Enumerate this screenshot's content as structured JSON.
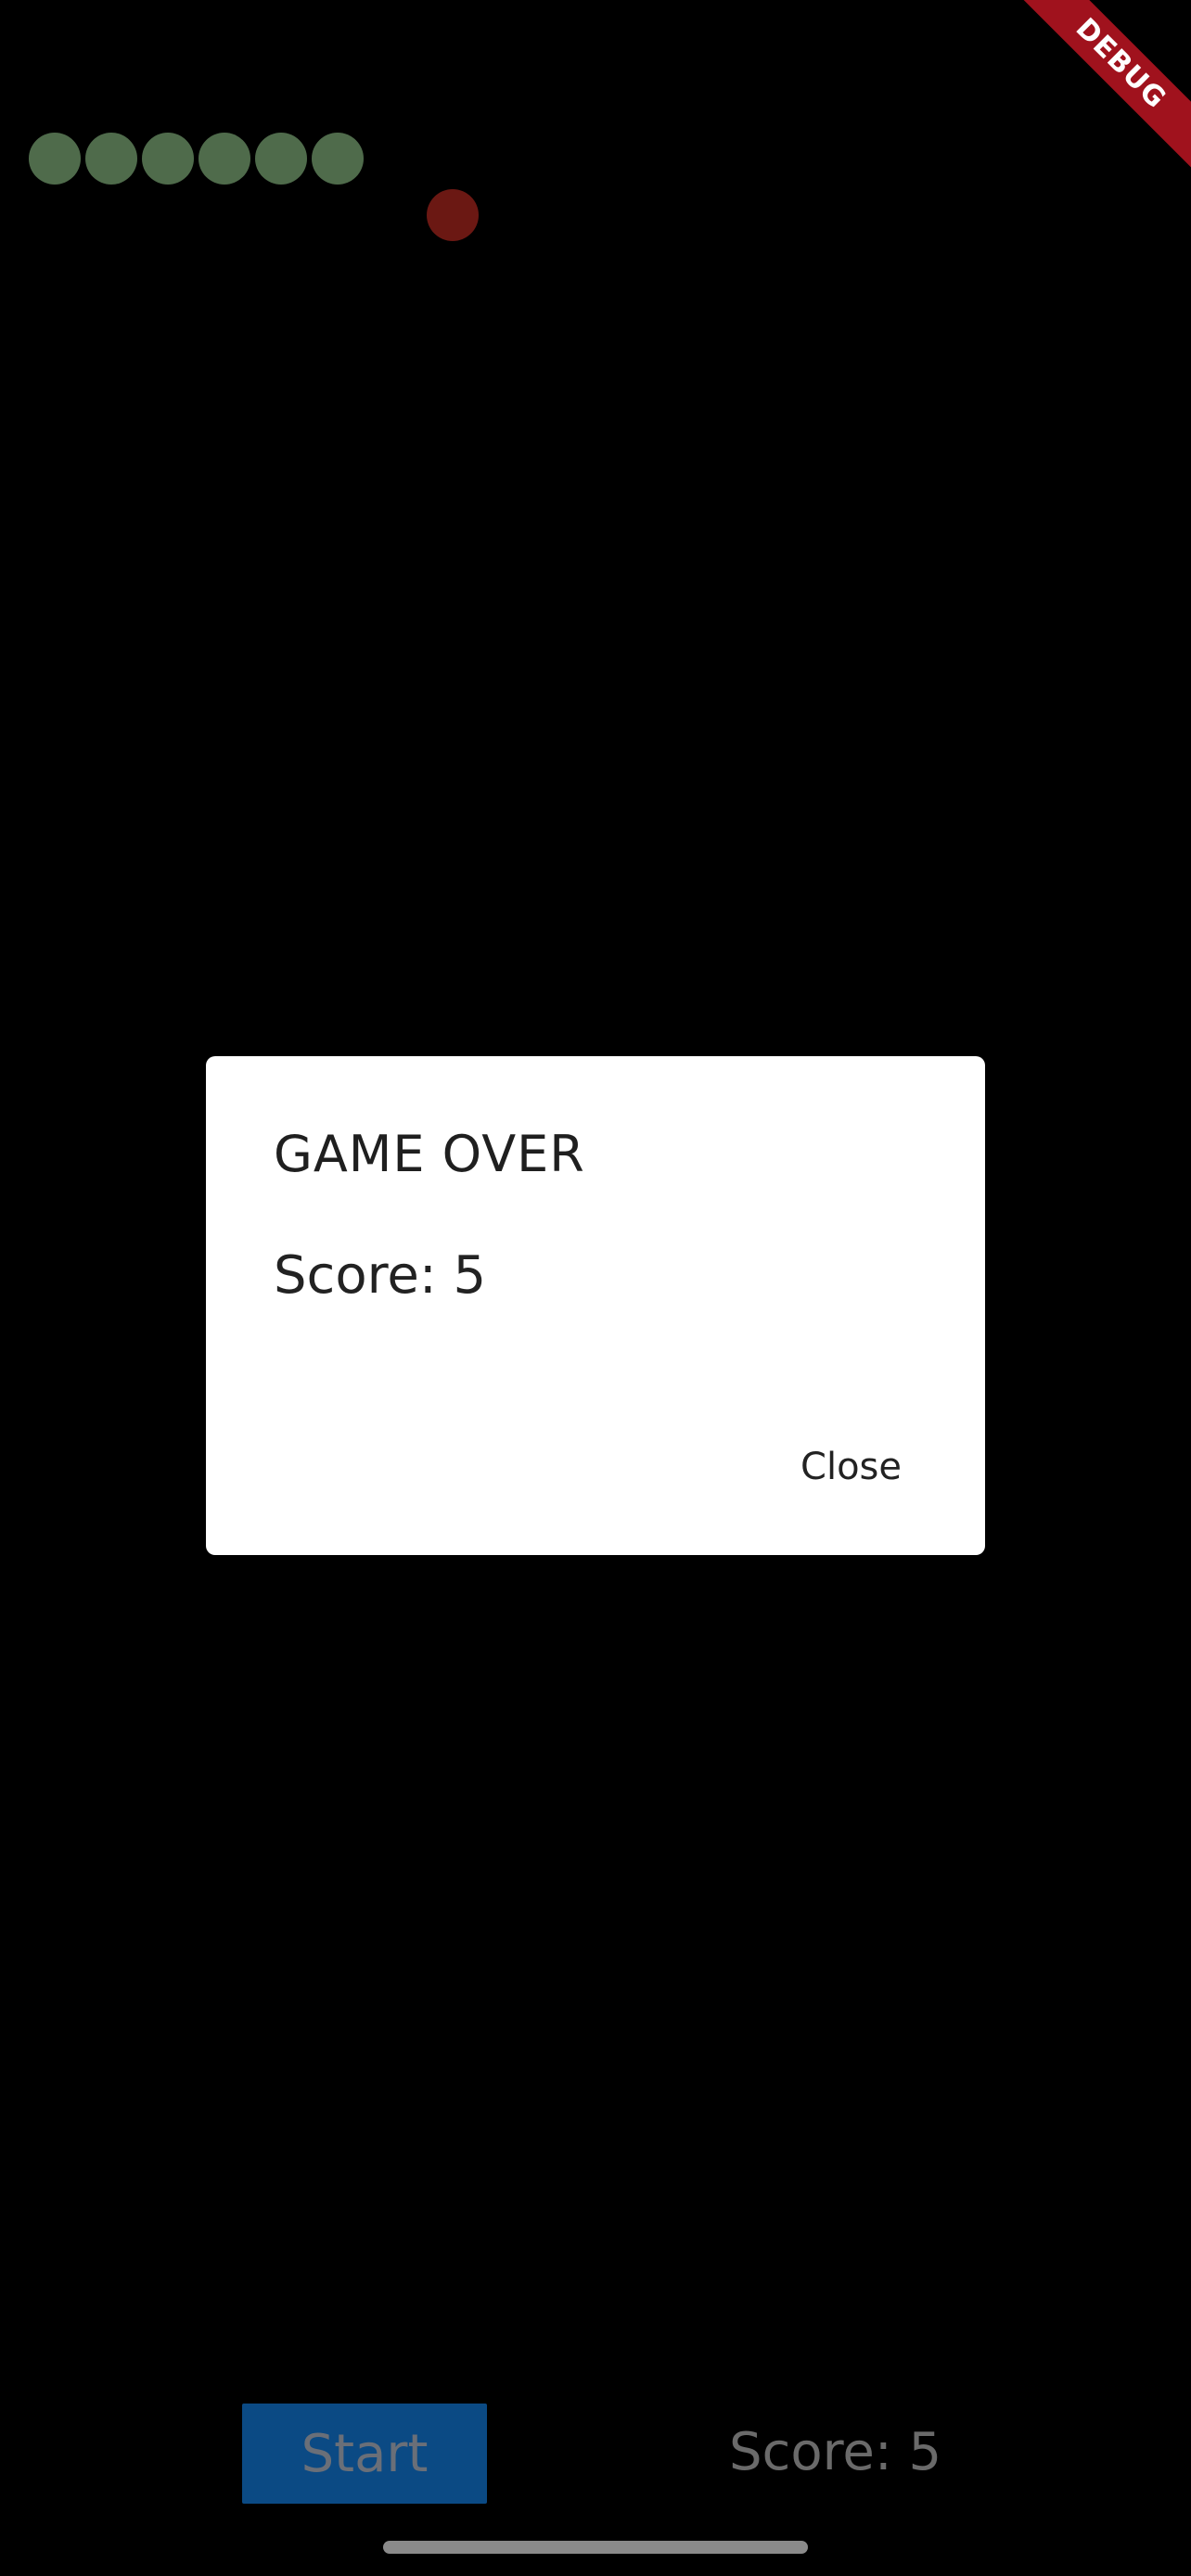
{
  "game": {
    "snake_segments": 6,
    "snake_color": "#4f6b4b",
    "food_color": "#6b1813",
    "background_color": "#000000"
  },
  "dialog": {
    "title": "GAME OVER",
    "content": "Score: 5",
    "close_label": "Close"
  },
  "controls": {
    "start_label": "Start",
    "start_color": "#0b4a84",
    "score_text": "Score: 5"
  },
  "debug_banner": {
    "label": "DEBUG",
    "color": "#a0121d"
  }
}
